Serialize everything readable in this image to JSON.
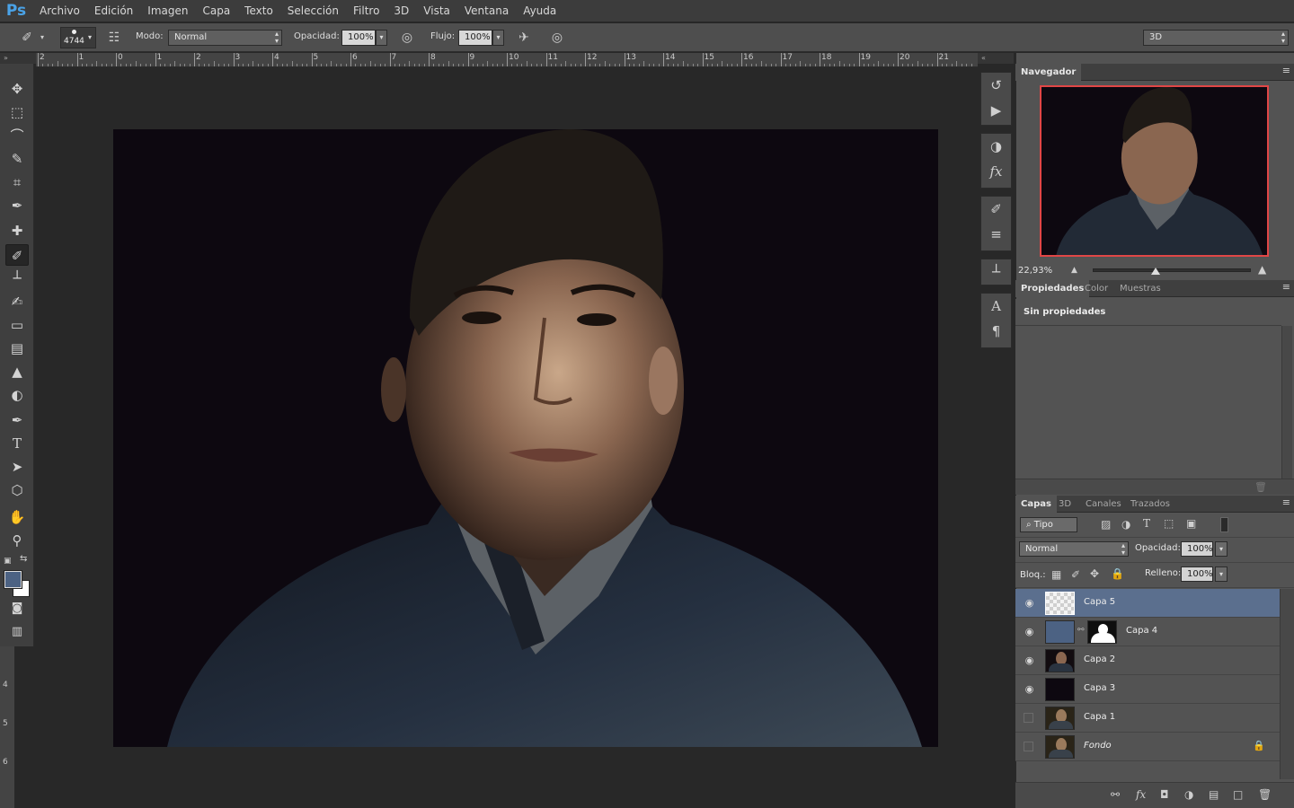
{
  "app": {
    "logo": "Ps"
  },
  "menu": [
    "Archivo",
    "Edición",
    "Imagen",
    "Capa",
    "Texto",
    "Selección",
    "Filtro",
    "3D",
    "Vista",
    "Ventana",
    "Ayuda"
  ],
  "options": {
    "brush_size": "4744",
    "mode_label": "Modo:",
    "mode_value": "Normal",
    "opacity_label": "Opacidad:",
    "opacity_value": "100%",
    "flow_label": "Flujo:",
    "flow_value": "100%",
    "workspace": "3D"
  },
  "ruler": {
    "top_ticks": [
      "2",
      "1",
      "0",
      "1",
      "2",
      "3",
      "4",
      "5",
      "6",
      "7",
      "8",
      "9",
      "10",
      "11",
      "12",
      "13",
      "14",
      "15",
      "16",
      "17",
      "18",
      "19",
      "20",
      "21"
    ],
    "left_ticks": [
      "4",
      "5",
      "6"
    ]
  },
  "navigator": {
    "tab": "Navegador",
    "zoom": "22,93%"
  },
  "properties": {
    "tabs": [
      "Propiedades",
      "Color",
      "Muestras"
    ],
    "content": "Sin propiedades"
  },
  "layers": {
    "tabs": [
      "Capas",
      "3D",
      "Canales",
      "Trazados"
    ],
    "filter_kind": "Tipo",
    "blend_mode": "Normal",
    "opacity_label": "Opacidad:",
    "opacity_value": "100%",
    "lock_label": "Bloq.:",
    "fill_label": "Relleno:",
    "fill_value": "100%",
    "items": [
      {
        "name": "Capa 5",
        "visible": true,
        "selected": true,
        "thumb": "transparent"
      },
      {
        "name": "Capa 4",
        "visible": true,
        "selected": false,
        "thumb": "blue-mask"
      },
      {
        "name": "Capa 2",
        "visible": true,
        "selected": false,
        "thumb": "photo"
      },
      {
        "name": "Capa 3",
        "visible": true,
        "selected": false,
        "thumb": "dark"
      },
      {
        "name": "Capa 1",
        "visible": false,
        "selected": false,
        "thumb": "photo"
      },
      {
        "name": "Fondo",
        "visible": false,
        "selected": false,
        "thumb": "photo",
        "locked": true
      }
    ]
  },
  "colors": {
    "foreground": "#4c6283",
    "background": "#ffffff",
    "selected_layer": "#5b6f8e",
    "navigator_frame": "#e04646"
  }
}
